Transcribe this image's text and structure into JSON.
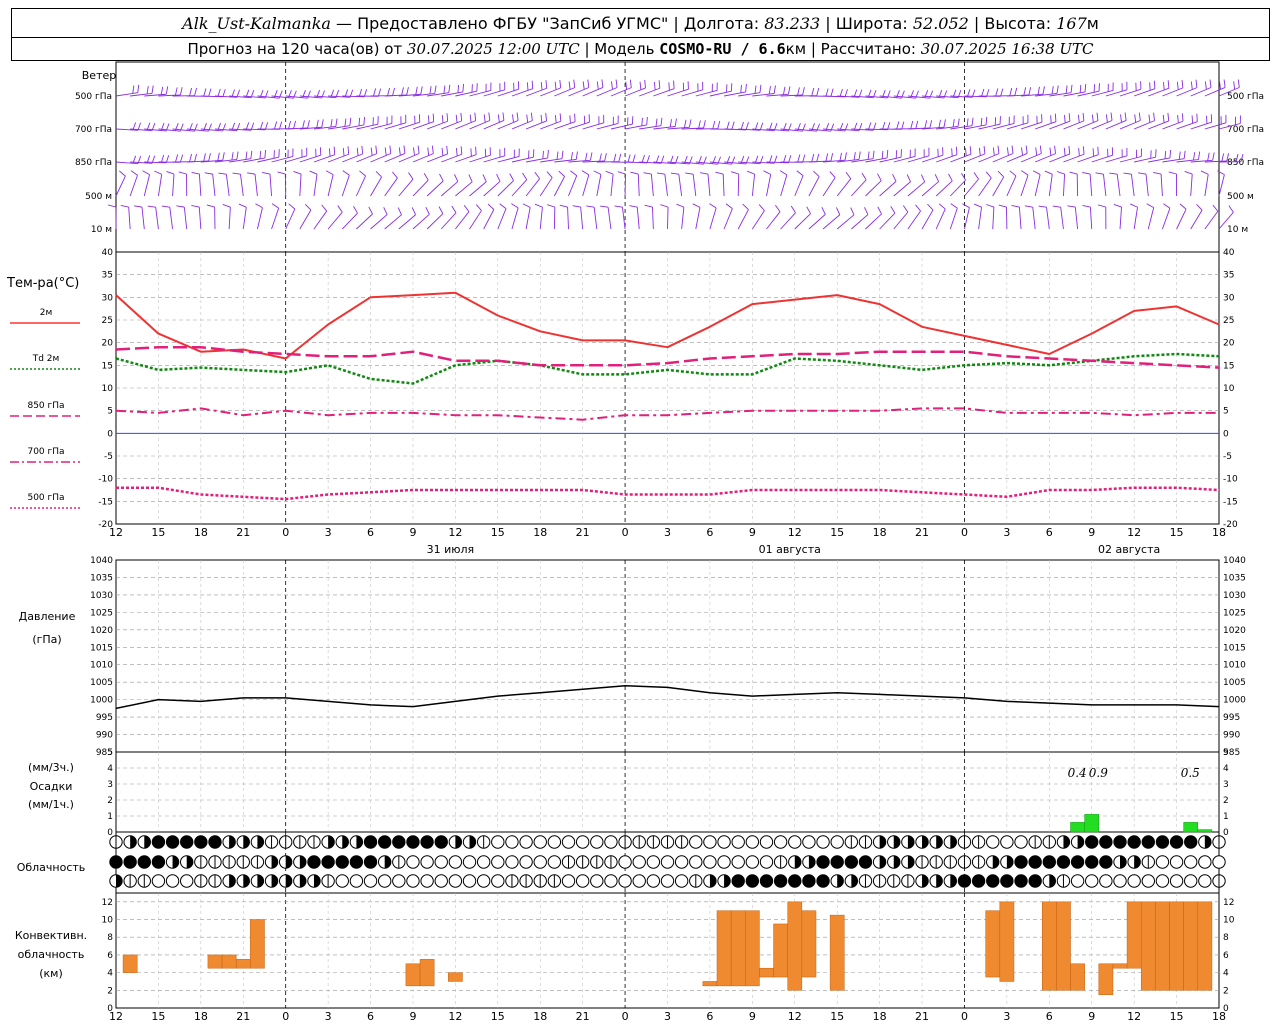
{
  "header": {
    "station": "Alk_Ust-Kalmanka",
    "provider": "Предоставлено ФГБУ \"ЗапСиб УГМС\"",
    "lon_label": "Долгота:",
    "lon": "83.233",
    "lat_label": "Широта:",
    "lat": "52.052",
    "alt_label": "Высота:",
    "alt": "167",
    "alt_unit": "м",
    "forecast_label": "Прогноз на 120 часа(ов) от",
    "forecast_time": "30.07.2025 12:00 UTC",
    "model_label": "Модель",
    "model": "COSMO-RU / 6.6",
    "model_unit": "км",
    "calc_label": "Рассчитано:",
    "calc_time": "30.07.2025 16:38 UTC"
  },
  "wind_panel": {
    "title": "Ветер",
    "levels": [
      "500 гПа",
      "700 гПа",
      "850 гПа",
      "500 м",
      "10 м"
    ]
  },
  "temp_panel": {
    "title": "Тем-ра(°С)",
    "legend": [
      {
        "label": "2м",
        "color": "#ff3333",
        "style": "solid"
      },
      {
        "label": "Td 2м",
        "color": "#118811",
        "style": "dotted"
      },
      {
        "label": "850 гПа",
        "color": "#e0207a",
        "style": "dashed"
      },
      {
        "label": "700 гПа",
        "color": "#e0207a",
        "style": "dashdot"
      },
      {
        "label": "500 гПа",
        "color": "#e0207a",
        "style": "dotted"
      }
    ]
  },
  "pressure_panel": {
    "title": "Давление",
    "unit": "(гПа)"
  },
  "precip_panel": {
    "unit1": "(мм/3ч.)",
    "title": "Осадки",
    "unit2": "(мм/1ч.)"
  },
  "cloud_panel": {
    "title": "Облачность"
  },
  "conv_panel": {
    "title1": "Конвективн.",
    "title2": "облачность",
    "unit": "(км)"
  },
  "date_labels": [
    "31 июля",
    "01 августа",
    "02 августа"
  ],
  "time_ticks": [
    "12",
    "15",
    "18",
    "21",
    "0",
    "3",
    "6",
    "9",
    "12",
    "15",
    "18",
    "21",
    "0",
    "3",
    "6",
    "9",
    "12",
    "15",
    "18",
    "21",
    "0",
    "3",
    "6",
    "9",
    "12",
    "15",
    "18"
  ],
  "chart_data": [
    {
      "type": "line",
      "title": "Тем-ра(°С)",
      "x": [
        0,
        3,
        6,
        9,
        12,
        15,
        18,
        21,
        24,
        27,
        30,
        33,
        36,
        39,
        42,
        45,
        48,
        51,
        54,
        57,
        60,
        63,
        66,
        69,
        72,
        75,
        78
      ],
      "ylim": [
        -20,
        40
      ],
      "series": [
        {
          "name": "2м",
          "values": [
            30.5,
            22,
            18,
            18.5,
            16.5,
            24,
            30,
            30.5,
            31,
            26,
            22.5,
            20.5,
            20.5,
            19,
            23.5,
            28.5,
            29.5,
            30.5,
            28.5,
            23.5,
            21.5,
            19.5,
            17.5,
            22,
            27,
            28,
            24
          ]
        },
        {
          "name": "Td 2м",
          "values": [
            16.5,
            14,
            14.5,
            14,
            13.5,
            15,
            12,
            11,
            15,
            16,
            15,
            13,
            13,
            14,
            13,
            13,
            16.5,
            16,
            15,
            14,
            15,
            15.5,
            15,
            16,
            17,
            17.5,
            17
          ]
        },
        {
          "name": "850 гПа",
          "values": [
            18.5,
            19,
            19,
            18,
            17.5,
            17,
            17,
            18,
            16,
            16,
            15,
            15,
            15,
            15.5,
            16.5,
            17,
            17.5,
            17.5,
            18,
            18,
            18,
            17,
            16.5,
            16,
            15.5,
            15,
            14.5
          ]
        },
        {
          "name": "700 гПа",
          "values": [
            5,
            4.5,
            5.5,
            4,
            5,
            4,
            4.5,
            4.5,
            4,
            4,
            3.5,
            3,
            4,
            4,
            4.5,
            5,
            5,
            5,
            5,
            5.5,
            5.5,
            4.5,
            4.5,
            4.5,
            4,
            4.5,
            4.5
          ]
        },
        {
          "name": "500 гПа",
          "values": [
            -12,
            -12,
            -13.5,
            -14,
            -14.5,
            -13.5,
            -13,
            -12.5,
            -12.5,
            -12.5,
            -12.5,
            -12.5,
            -13.5,
            -13.5,
            -13.5,
            -12.5,
            -12.5,
            -12.5,
            -12.5,
            -13,
            -13.5,
            -14,
            -12.5,
            -12.5,
            -12,
            -12,
            -12.5
          ]
        }
      ]
    },
    {
      "type": "line",
      "title": "Давление",
      "x": [
        0,
        3,
        6,
        9,
        12,
        15,
        18,
        21,
        24,
        27,
        30,
        33,
        36,
        39,
        42,
        45,
        48,
        51,
        54,
        57,
        60,
        63,
        66,
        69,
        72,
        75,
        78
      ],
      "ylim": [
        985,
        1040
      ],
      "series": [
        {
          "name": "Давление",
          "values": [
            997.5,
            1000,
            999.5,
            1000.5,
            1000.5,
            999.5,
            998.5,
            998,
            999.5,
            1001,
            1002,
            1003,
            1004,
            1003.5,
            1002,
            1001,
            1001.5,
            1002,
            1001.5,
            1001,
            1000.5,
            999.5,
            999,
            998.5,
            998.5,
            998.5,
            998
          ]
        }
      ]
    },
    {
      "type": "bar",
      "title": "Осадки",
      "x": [
        68,
        69,
        76,
        77
      ],
      "values": [
        0.6,
        1.1,
        0.6,
        0.15
      ],
      "annotations": [
        "0.4",
        "0.9",
        "0.5"
      ],
      "ylim": [
        0,
        5
      ]
    },
    {
      "type": "bar",
      "title": "Конвективн. облачность",
      "x": [
        1,
        7,
        8,
        9,
        10,
        21,
        22,
        24,
        42,
        43,
        44,
        45,
        46,
        47,
        48,
        49,
        51,
        62,
        63,
        66,
        67,
        68,
        69,
        70,
        71,
        72,
        73,
        74,
        75,
        76,
        77
      ],
      "bottom": [
        4,
        4.5,
        4.5,
        4.5,
        4.5,
        2.5,
        2.5,
        3,
        2.5,
        2.5,
        2.5,
        2.5,
        3.5,
        3.5,
        2,
        3.5,
        2,
        3.5,
        3,
        2,
        2,
        2,
        4.5,
        1.5,
        4.5,
        4.5,
        2,
        2,
        2,
        2,
        2
      ],
      "top": [
        6,
        6,
        6,
        5.5,
        10,
        5,
        5.5,
        4,
        3,
        11,
        11,
        11,
        4.5,
        9.5,
        12,
        11,
        10.5,
        11,
        12,
        12,
        12,
        5,
        2,
        5,
        5,
        12,
        12,
        12,
        12,
        12,
        12
      ],
      "ylim": [
        0,
        13
      ]
    }
  ]
}
